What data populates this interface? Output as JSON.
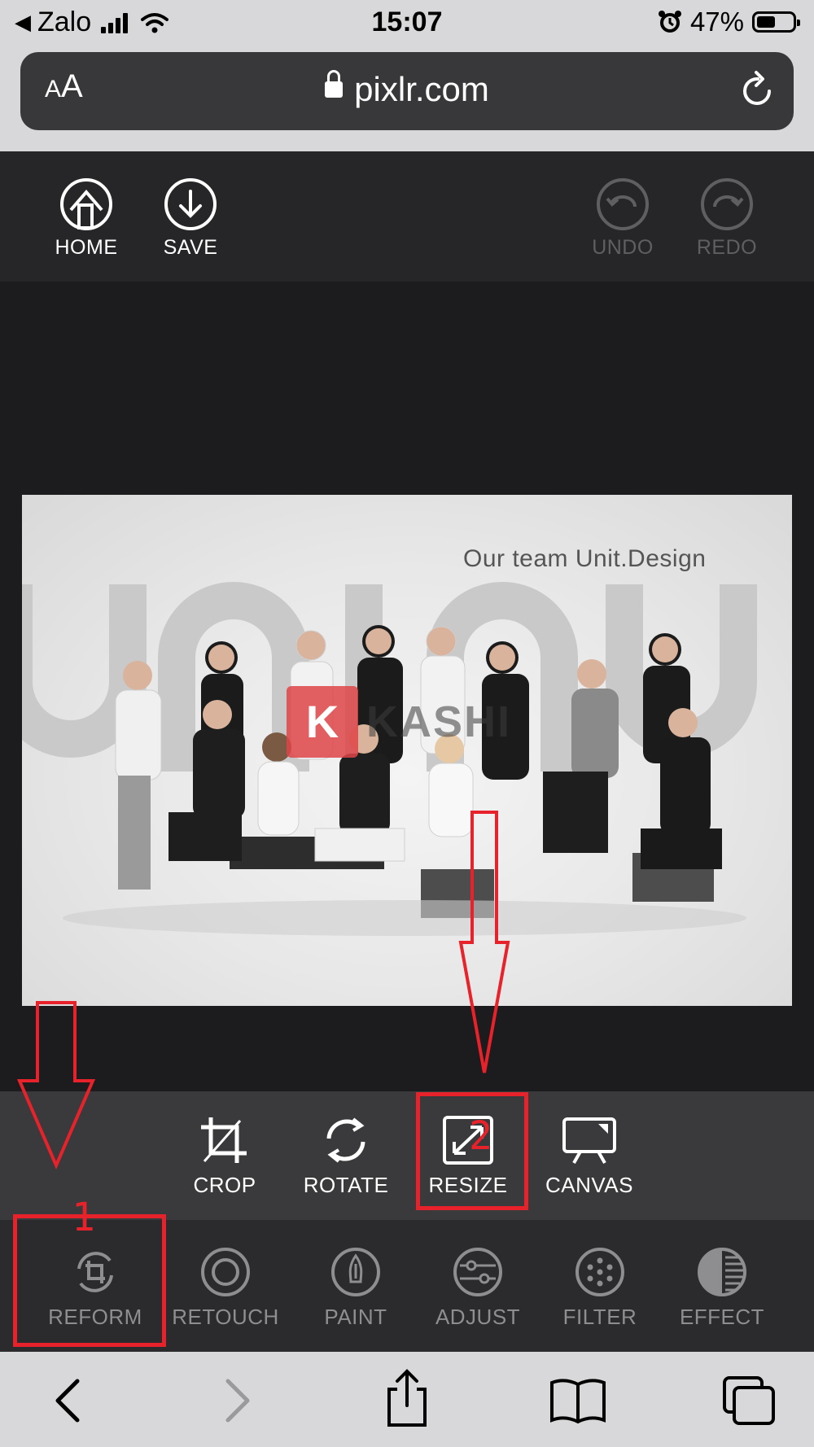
{
  "status_bar": {
    "back_app": "Zalo",
    "time": "15:07",
    "battery": "47%"
  },
  "browser": {
    "text_size_label": "AA",
    "url": "pixlr.com"
  },
  "editor_toolbar": {
    "home": "HOME",
    "save": "SAVE",
    "undo": "UNDO",
    "redo": "REDO"
  },
  "photo": {
    "caption": "Our team Unit.Design",
    "watermark_letter": "K",
    "watermark_text": "KASHI"
  },
  "reform_tools": [
    {
      "label": "CROP",
      "icon": "crop-icon"
    },
    {
      "label": "ROTATE",
      "icon": "rotate-icon"
    },
    {
      "label": "RESIZE",
      "icon": "resize-icon"
    },
    {
      "label": "CANVAS",
      "icon": "canvas-icon"
    }
  ],
  "main_tools": [
    {
      "label": "REFORM",
      "icon": "reform-icon",
      "active": true
    },
    {
      "label": "RETOUCH",
      "icon": "retouch-icon"
    },
    {
      "label": "PAINT",
      "icon": "paint-icon"
    },
    {
      "label": "ADJUST",
      "icon": "adjust-icon"
    },
    {
      "label": "FILTER",
      "icon": "filter-icon"
    },
    {
      "label": "EFFECT",
      "icon": "effect-icon"
    }
  ],
  "annotations": {
    "step1": "1",
    "step2": "2",
    "color": "#e8222a"
  },
  "colors": {
    "editor_bg": "#1d1d1f",
    "toolbar": "#262628",
    "sub_toolbar": "#3a3a3c",
    "main_toolbar": "#2b2b2d",
    "safari_chrome": "#d8d8da"
  }
}
